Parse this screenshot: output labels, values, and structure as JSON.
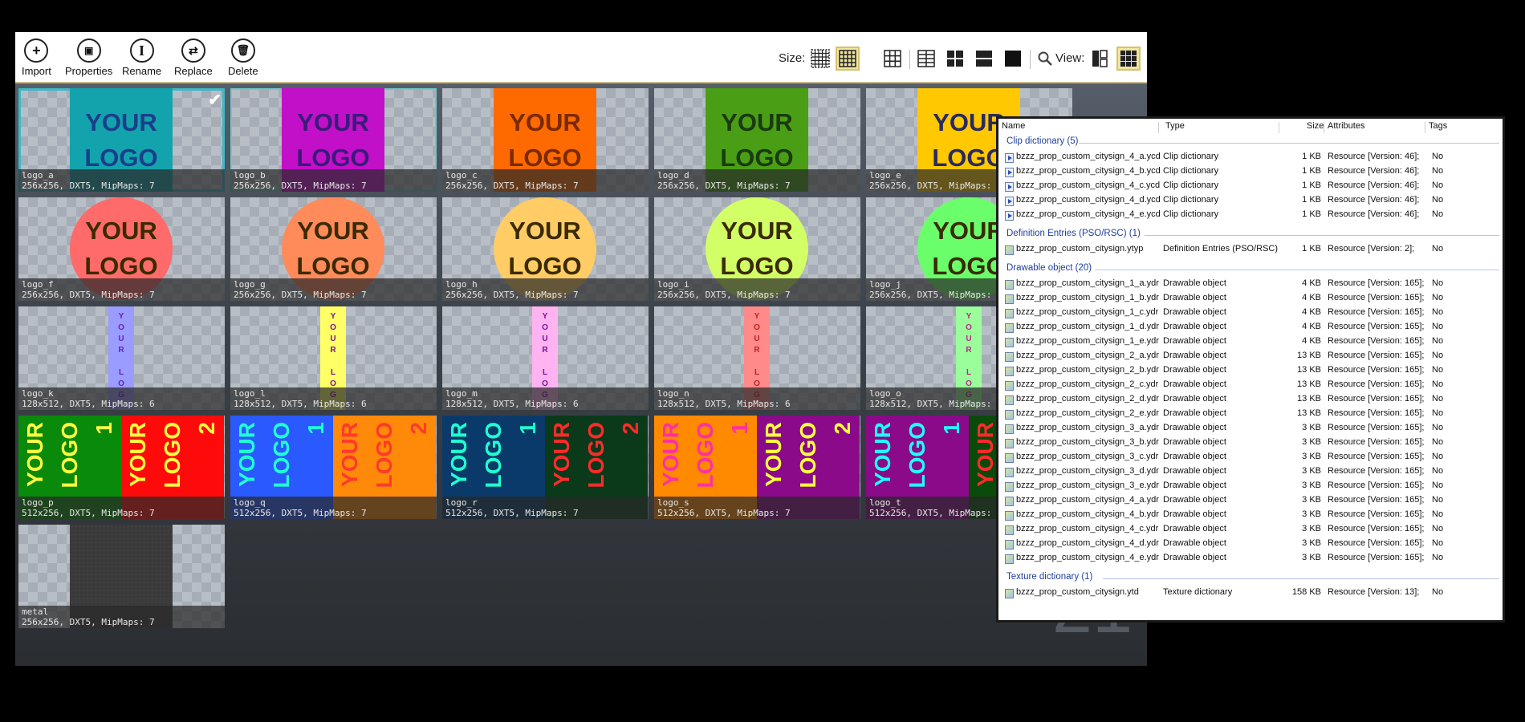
{
  "toolbar": {
    "buttons": [
      {
        "label": "Import",
        "icon": "+"
      },
      {
        "label": "Properties",
        "icon": "▣"
      },
      {
        "label": "Rename",
        "icon": "I"
      },
      {
        "label": "Replace",
        "icon": "⇄"
      },
      {
        "label": "Delete",
        "icon": "🗑"
      }
    ],
    "size_label": "Size:",
    "view_label": "View:",
    "search_icon": "🔍"
  },
  "tiles": [
    {
      "name": "logo_a",
      "info": "256x256, DXT5, MipMaps: 7"
    },
    {
      "name": "logo_b",
      "info": "256x256, DXT5, MipMaps: 7"
    },
    {
      "name": "logo_c",
      "info": "256x256, DXT5, MipMaps: 7"
    },
    {
      "name": "logo_d",
      "info": "256x256, DXT5, MipMaps: 7"
    },
    {
      "name": "logo_e",
      "info": "256x256, DXT5, MipMaps: 7"
    },
    {
      "name": "logo_f",
      "info": "256x256, DXT5, MipMaps: 7"
    },
    {
      "name": "logo_g",
      "info": "256x256, DXT5, MipMaps: 7"
    },
    {
      "name": "logo_h",
      "info": "256x256, DXT5, MipMaps: 7"
    },
    {
      "name": "logo_i",
      "info": "256x256, DXT5, MipMaps: 7"
    },
    {
      "name": "logo_j",
      "info": "256x256, DXT5, MipMaps: 7"
    },
    {
      "name": "logo_k",
      "info": "128x512, DXT5, MipMaps: 6"
    },
    {
      "name": "logo_l",
      "info": "128x512, DXT5, MipMaps: 6"
    },
    {
      "name": "logo_m",
      "info": "128x512, DXT5, MipMaps: 6"
    },
    {
      "name": "logo_n",
      "info": "128x512, DXT5, MipMaps: 6"
    },
    {
      "name": "logo_o",
      "info": "128x512, DXT5, MipMaps: 6"
    },
    {
      "name": "logo_p",
      "info": "512x256, DXT5, MipMaps: 7"
    },
    {
      "name": "logo_q",
      "info": "512x256, DXT5, MipMaps: 7"
    },
    {
      "name": "logo_r",
      "info": "512x256, DXT5, MipMaps: 7"
    },
    {
      "name": "logo_s",
      "info": "512x256, DXT5, MipMaps: 7"
    },
    {
      "name": "logo_t",
      "info": "512x256, DXT5, MipMaps: 7"
    },
    {
      "name": "metal",
      "info": "256x256, DXT5, MipMaps: 7"
    }
  ],
  "logo_text": {
    "w1": "YOUR",
    "w2": "LOGO",
    "vertical": "YOUR LOG",
    "one": "1",
    "two": "2"
  },
  "count": "21",
  "panel": {
    "headers": {
      "name": "Name",
      "type": "Type",
      "size": "Size",
      "attributes": "Attributes",
      "tags": "Tags"
    },
    "groups": [
      {
        "title": "Clip dictionary (5)",
        "rows": [
          {
            "name": "bzzz_prop_custom_citysign_4_a.ycd",
            "type": "Clip dictionary",
            "size": "1 KB",
            "attr": "Resource [Version: 46];",
            "tags": "No"
          },
          {
            "name": "bzzz_prop_custom_citysign_4_b.ycd",
            "type": "Clip dictionary",
            "size": "1 KB",
            "attr": "Resource [Version: 46];",
            "tags": "No"
          },
          {
            "name": "bzzz_prop_custom_citysign_4_c.ycd",
            "type": "Clip dictionary",
            "size": "1 KB",
            "attr": "Resource [Version: 46];",
            "tags": "No"
          },
          {
            "name": "bzzz_prop_custom_citysign_4_d.ycd",
            "type": "Clip dictionary",
            "size": "1 KB",
            "attr": "Resource [Version: 46];",
            "tags": "No"
          },
          {
            "name": "bzzz_prop_custom_citysign_4_e.ycd",
            "type": "Clip dictionary",
            "size": "1 KB",
            "attr": "Resource [Version: 46];",
            "tags": "No"
          }
        ]
      },
      {
        "title": "Definition Entries (PSO/RSC) (1)",
        "rows": [
          {
            "name": "bzzz_prop_custom_citysign.ytyp",
            "type": "Definition Entries (PSO/RSC)",
            "size": "1 KB",
            "attr": "Resource [Version: 2];",
            "tags": "No"
          }
        ]
      },
      {
        "title": "Drawable object (20)",
        "rows": [
          {
            "name": "bzzz_prop_custom_citysign_1_a.ydr",
            "type": "Drawable object",
            "size": "4 KB",
            "attr": "Resource [Version: 165];",
            "tags": "No"
          },
          {
            "name": "bzzz_prop_custom_citysign_1_b.ydr",
            "type": "Drawable object",
            "size": "4 KB",
            "attr": "Resource [Version: 165];",
            "tags": "No"
          },
          {
            "name": "bzzz_prop_custom_citysign_1_c.ydr",
            "type": "Drawable object",
            "size": "4 KB",
            "attr": "Resource [Version: 165];",
            "tags": "No"
          },
          {
            "name": "bzzz_prop_custom_citysign_1_d.ydr",
            "type": "Drawable object",
            "size": "4 KB",
            "attr": "Resource [Version: 165];",
            "tags": "No"
          },
          {
            "name": "bzzz_prop_custom_citysign_1_e.ydr",
            "type": "Drawable object",
            "size": "4 KB",
            "attr": "Resource [Version: 165];",
            "tags": "No"
          },
          {
            "name": "bzzz_prop_custom_citysign_2_a.ydr",
            "type": "Drawable object",
            "size": "13 KB",
            "attr": "Resource [Version: 165];",
            "tags": "No"
          },
          {
            "name": "bzzz_prop_custom_citysign_2_b.ydr",
            "type": "Drawable object",
            "size": "13 KB",
            "attr": "Resource [Version: 165];",
            "tags": "No"
          },
          {
            "name": "bzzz_prop_custom_citysign_2_c.ydr",
            "type": "Drawable object",
            "size": "13 KB",
            "attr": "Resource [Version: 165];",
            "tags": "No"
          },
          {
            "name": "bzzz_prop_custom_citysign_2_d.ydr",
            "type": "Drawable object",
            "size": "13 KB",
            "attr": "Resource [Version: 165];",
            "tags": "No"
          },
          {
            "name": "bzzz_prop_custom_citysign_2_e.ydr",
            "type": "Drawable object",
            "size": "13 KB",
            "attr": "Resource [Version: 165];",
            "tags": "No"
          },
          {
            "name": "bzzz_prop_custom_citysign_3_a.ydr",
            "type": "Drawable object",
            "size": "3 KB",
            "attr": "Resource [Version: 165];",
            "tags": "No"
          },
          {
            "name": "bzzz_prop_custom_citysign_3_b.ydr",
            "type": "Drawable object",
            "size": "3 KB",
            "attr": "Resource [Version: 165];",
            "tags": "No"
          },
          {
            "name": "bzzz_prop_custom_citysign_3_c.ydr",
            "type": "Drawable object",
            "size": "3 KB",
            "attr": "Resource [Version: 165];",
            "tags": "No"
          },
          {
            "name": "bzzz_prop_custom_citysign_3_d.ydr",
            "type": "Drawable object",
            "size": "3 KB",
            "attr": "Resource [Version: 165];",
            "tags": "No"
          },
          {
            "name": "bzzz_prop_custom_citysign_3_e.ydr",
            "type": "Drawable object",
            "size": "3 KB",
            "attr": "Resource [Version: 165];",
            "tags": "No"
          },
          {
            "name": "bzzz_prop_custom_citysign_4_a.ydr",
            "type": "Drawable object",
            "size": "3 KB",
            "attr": "Resource [Version: 165];",
            "tags": "No"
          },
          {
            "name": "bzzz_prop_custom_citysign_4_b.ydr",
            "type": "Drawable object",
            "size": "3 KB",
            "attr": "Resource [Version: 165];",
            "tags": "No"
          },
          {
            "name": "bzzz_prop_custom_citysign_4_c.ydr",
            "type": "Drawable object",
            "size": "3 KB",
            "attr": "Resource [Version: 165];",
            "tags": "No"
          },
          {
            "name": "bzzz_prop_custom_citysign_4_d.ydr",
            "type": "Drawable object",
            "size": "3 KB",
            "attr": "Resource [Version: 165];",
            "tags": "No"
          },
          {
            "name": "bzzz_prop_custom_citysign_4_e.ydr",
            "type": "Drawable object",
            "size": "3 KB",
            "attr": "Resource [Version: 165];",
            "tags": "No"
          }
        ]
      },
      {
        "title": "Texture dictionary (1)",
        "rows": [
          {
            "name": "bzzz_prop_custom_citysign.ytd",
            "type": "Texture dictionary",
            "size": "158 KB",
            "attr": "Resource [Version: 13];",
            "tags": "No"
          }
        ]
      }
    ]
  },
  "colors": {
    "accent": "#3fb8c6",
    "group_title": "#1f3f9c",
    "square_logos": [
      "#13a3ad",
      "#c210c8",
      "#ff6a00",
      "#4a9e16",
      "#ffc800"
    ],
    "square_text": [
      "#1a3f8a",
      "#3a1a7a",
      "#7a2a00",
      "#1a3a10",
      "#2a2a60"
    ],
    "circle_logos": [
      "#ff6a6a",
      "#ff8a5a",
      "#ffcc66",
      "#d2ff66",
      "#6aff6a"
    ],
    "circle_text": "#3a2a00",
    "strip_logos": [
      "#9a9cff",
      "#ffff66",
      "#ffb3f0",
      "#ff8a8a",
      "#9aff9a"
    ],
    "strip_text": [
      "#6a20c0",
      "#7a10a0",
      "#7a10a0",
      "#c02020",
      "#c02090"
    ],
    "wide_logos": [
      [
        "#0a8a0a",
        "#ff0a0a",
        "#ffff40",
        "#ffff40"
      ],
      [
        "#2a5aff",
        "#ff8a0a",
        "#20ffd0",
        "#ff3a2a"
      ],
      [
        "#0a3a6a",
        "#0a3a1a",
        "#20ffd0",
        "#ff2a2a"
      ],
      [
        "#ff8a00",
        "#8a0a8a",
        "#ff30a0",
        "#ffff40"
      ],
      [
        "#8a0a8a",
        "#0a4a0a",
        "#20ffff",
        "#ff2a2a"
      ]
    ]
  }
}
